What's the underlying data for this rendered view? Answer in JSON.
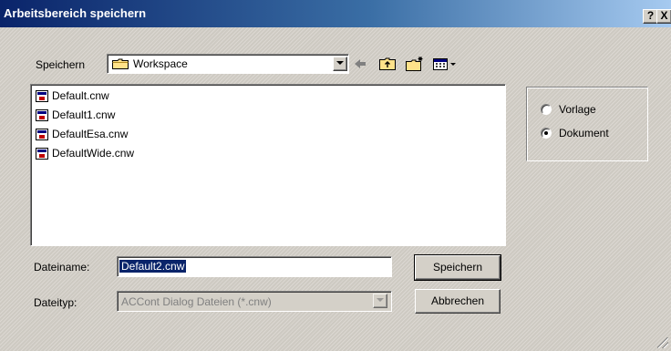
{
  "window": {
    "title": "Arbeitsbereich speichern",
    "help_glyph": "?",
    "close_glyph": "X",
    "accent": "#0a246a"
  },
  "save_in": {
    "label": "Speichern",
    "folder": "Workspace",
    "toolbar_icons": [
      "back-arrow-icon",
      "up-folder-icon",
      "new-folder-icon",
      "view-menu-icon"
    ]
  },
  "files": [
    {
      "name": "Default.cnw"
    },
    {
      "name": "Default1.cnw"
    },
    {
      "name": "DefaultEsa.cnw"
    },
    {
      "name": "DefaultWide.cnw"
    }
  ],
  "options": {
    "vorlage_label": "Vorlage",
    "dokument_label": "Dokument",
    "selected": "Dokument"
  },
  "filename": {
    "label": "Dateiname:",
    "value": "Default2.cnw"
  },
  "filetype": {
    "label": "Dateityp:",
    "value": "ACCont Dialog Dateien (*.cnw)"
  },
  "buttons": {
    "save": "Speichern",
    "cancel": "Abbrechen"
  }
}
